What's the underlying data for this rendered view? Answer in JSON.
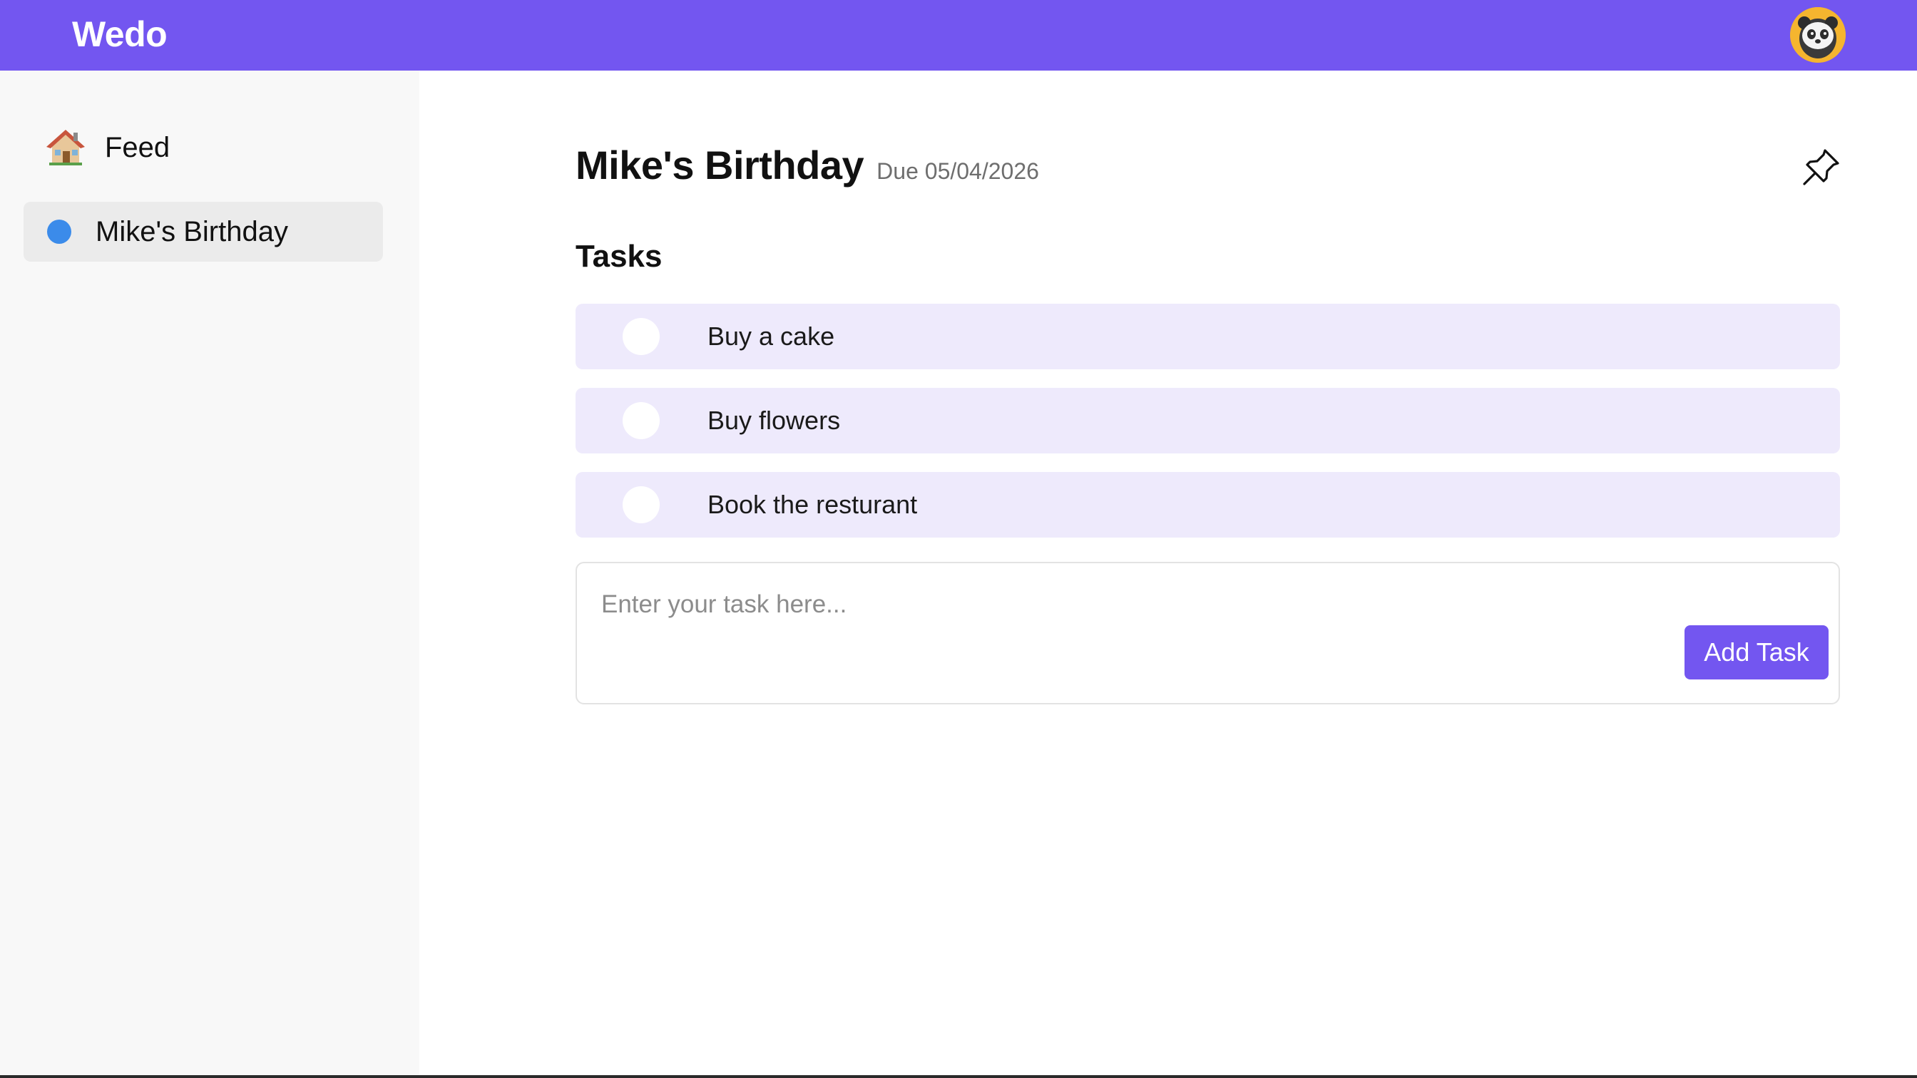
{
  "header": {
    "brand": "Wedo",
    "brand_color": "#7356f0",
    "avatar_icon": "panda-avatar-icon"
  },
  "sidebar": {
    "items": [
      {
        "label": "Feed",
        "icon": "house-icon",
        "active": false
      },
      {
        "label": "Mike's Birthday",
        "icon": "blue-dot-icon",
        "icon_color": "#3b8bea",
        "active": true
      }
    ]
  },
  "main": {
    "title": "Mike's Birthday",
    "due": "Due 05/04/2026",
    "pin_icon": "pin-icon",
    "tasks_heading": "Tasks",
    "tasks": [
      {
        "label": "Buy a cake",
        "done": false
      },
      {
        "label": "Buy flowers",
        "done": false
      },
      {
        "label": "Book the resturant",
        "done": false
      }
    ],
    "task_input": {
      "value": "",
      "placeholder": "Enter your task here..."
    },
    "add_button_label": "Add Task"
  }
}
